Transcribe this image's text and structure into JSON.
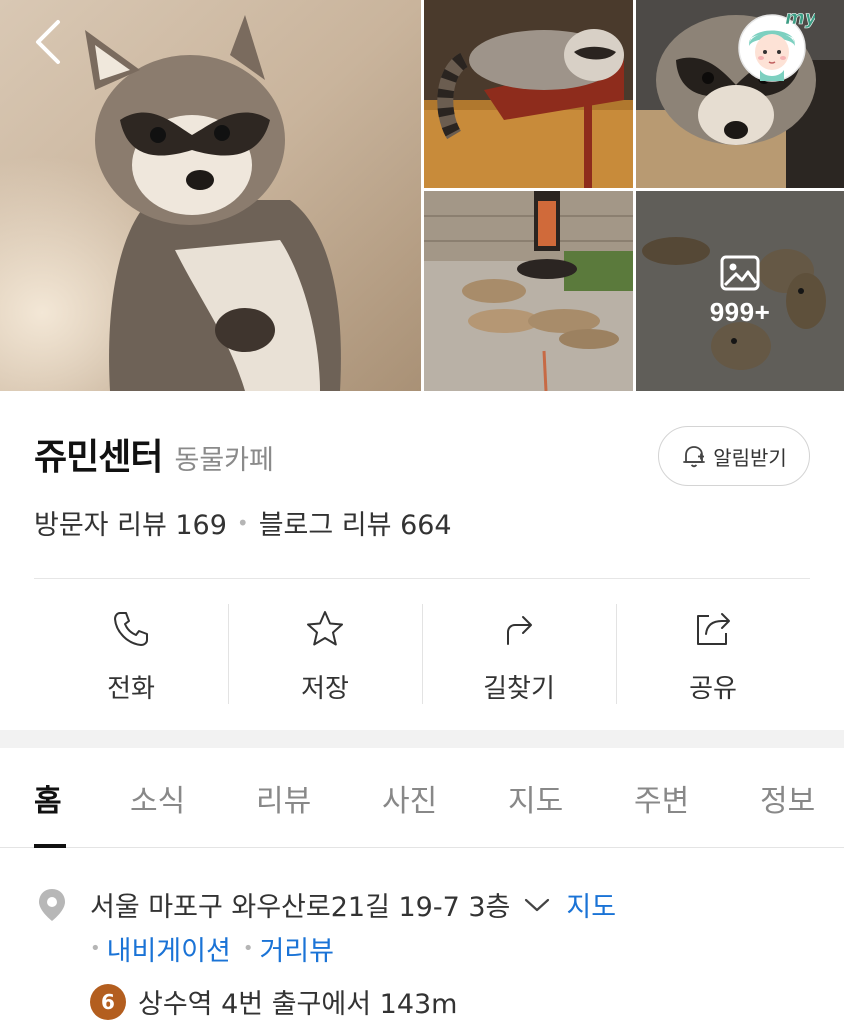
{
  "gallery": {
    "back_icon": "chevron-left-icon",
    "my_badge": "my",
    "more_icon": "image-icon",
    "more_count": "999+"
  },
  "place": {
    "name": "쥬민센터",
    "category": "동물카페",
    "alarm_label": "알림받기",
    "alarm_icon": "bell-plus-icon",
    "visitor_review": "방문자 리뷰 169",
    "blog_review": "블로그 리뷰 664"
  },
  "actions": [
    {
      "label": "전화",
      "icon": "phone-icon"
    },
    {
      "label": "저장",
      "icon": "star-icon"
    },
    {
      "label": "길찾기",
      "icon": "directions-icon"
    },
    {
      "label": "공유",
      "icon": "share-icon"
    }
  ],
  "tabs": [
    {
      "label": "홈",
      "active": true
    },
    {
      "label": "소식"
    },
    {
      "label": "리뷰"
    },
    {
      "label": "사진"
    },
    {
      "label": "지도"
    },
    {
      "label": "주변"
    },
    {
      "label": "정보"
    }
  ],
  "info": {
    "address": "서울 마포구 와우산로21길 19-7 3층",
    "map_link": "지도",
    "navigation_link": "내비게이션",
    "street_view_link": "거리뷰",
    "subway_line": "6",
    "subway_line_color": "#b35e1f",
    "subway_text": "상수역 4번 출구에서 143m"
  },
  "colors": {
    "link": "#1a73d6",
    "text": "#222222",
    "muted": "#8a8a8a"
  }
}
